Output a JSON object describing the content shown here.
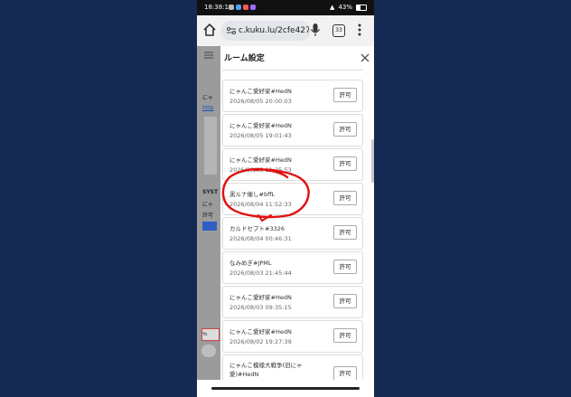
{
  "status_bar": {
    "time": "18:38:18",
    "battery": "43%"
  },
  "browser": {
    "url": "c.kuku.lu/2cfe427",
    "tab_count": "33"
  },
  "background_page": {
    "strip_label_1": "にゃ",
    "strip_label_2": "http",
    "strip_label_3": "SYST",
    "strip_label_4": "にゃ",
    "strip_label_5": "許可",
    "strip_label_6": "Yo"
  },
  "dialog": {
    "title": "ルーム設定",
    "allow_label": "許可",
    "entries": [
      {
        "name": "にゃんこ愛好家#HedN",
        "date": "2026/08/05 20:00:03"
      },
      {
        "name": "にゃんこ愛好家#HedN",
        "date": "2026/08/05 19:01:43"
      },
      {
        "name": "にゃんこ愛好家#HedN",
        "date": "2026/08/05 11:25:53"
      },
      {
        "name": "黒ルナ催し#bffL",
        "date": "2026/08/04 11:52:33"
      },
      {
        "name": "カルドセプト#3326",
        "date": "2026/08/04 00:46:31"
      },
      {
        "name": "なみめぎ#JPML",
        "date": "2026/08/03 21:45:44"
      },
      {
        "name": "にゃんこ愛好家#HedN",
        "date": "2026/08/03 09:35:15"
      },
      {
        "name": "にゃんこ愛好家#HedN",
        "date": "2026/08/02 19:27:39"
      },
      {
        "name": "にゃんこ模様大戦争(旧にゃ愛)#HedN",
        "date": ""
      }
    ]
  },
  "colors": {
    "background": "#152a52",
    "annotation": "#e01010"
  }
}
